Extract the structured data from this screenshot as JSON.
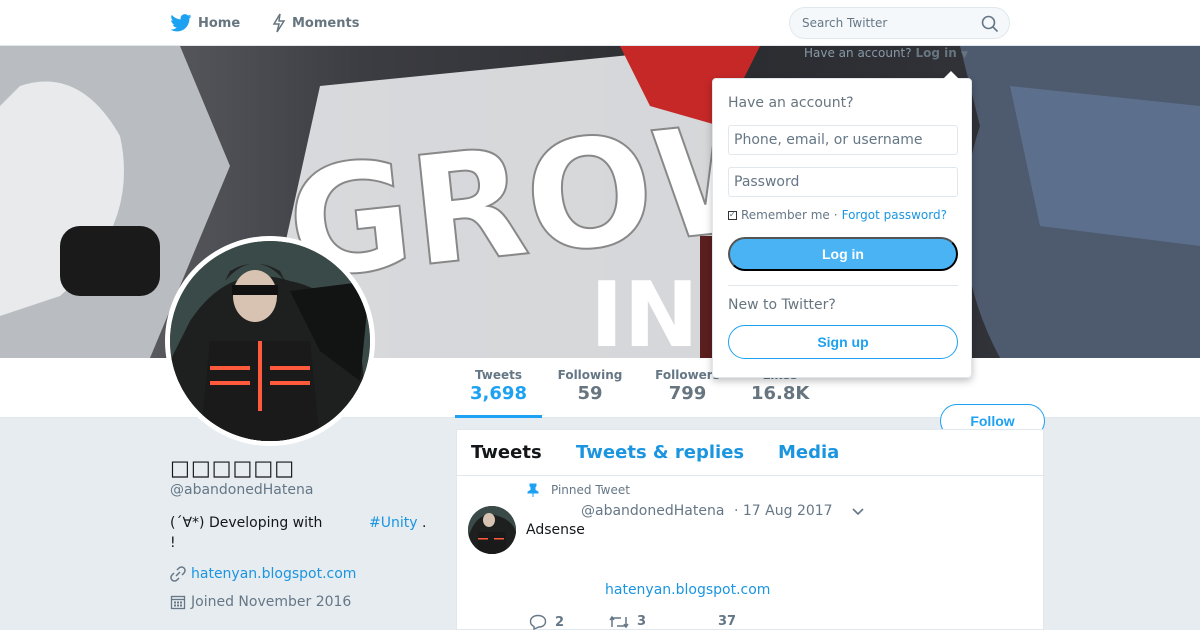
{
  "nav": {
    "home_label": "Home",
    "moments_label": "Moments",
    "search_placeholder": "Search Twitter"
  },
  "login_prompt": {
    "text": "Have an account?",
    "link": "Log in"
  },
  "banner": {
    "text": "GROW"
  },
  "stats": [
    {
      "label": "Tweets",
      "value": "3,698"
    },
    {
      "label": "Following",
      "value": "59"
    },
    {
      "label": "Followers",
      "value": "799"
    },
    {
      "label": "Likes",
      "value": "16.8K"
    }
  ],
  "follow_label": "Follow",
  "profile": {
    "name": "□□□□□□",
    "handle": "@abandonedHatena",
    "bio_text": "(´∀*) Developing with",
    "bio_hashtag": "#Unity",
    "bio_dot": ".",
    "bio_excl": "!",
    "website": "hatenyan.blogspot.com",
    "joined": "Joined November 2016"
  },
  "tabs": [
    "Tweets",
    "Tweets & replies",
    "Media"
  ],
  "tweet": {
    "pinned_label": "Pinned Tweet",
    "handle": "@abandonedHatena",
    "date": "· 17 Aug 2017",
    "text": "Adsense",
    "link": "hatenyan.blogspot.com",
    "replies": "2",
    "retweets": "3",
    "likes": "37"
  },
  "login_dropdown": {
    "title": "Have an account?",
    "username_placeholder": "Phone, email, or username",
    "password_placeholder": "Password",
    "remember": "Remember me",
    "separator": "·",
    "forgot": "Forgot password?",
    "login_button": "Log in",
    "new_text": "New to Twitter?",
    "signup_button": "Sign up"
  },
  "colors": {
    "accent": "#1da1f2",
    "link": "#1b95e0",
    "background": "#e6ecf0"
  }
}
